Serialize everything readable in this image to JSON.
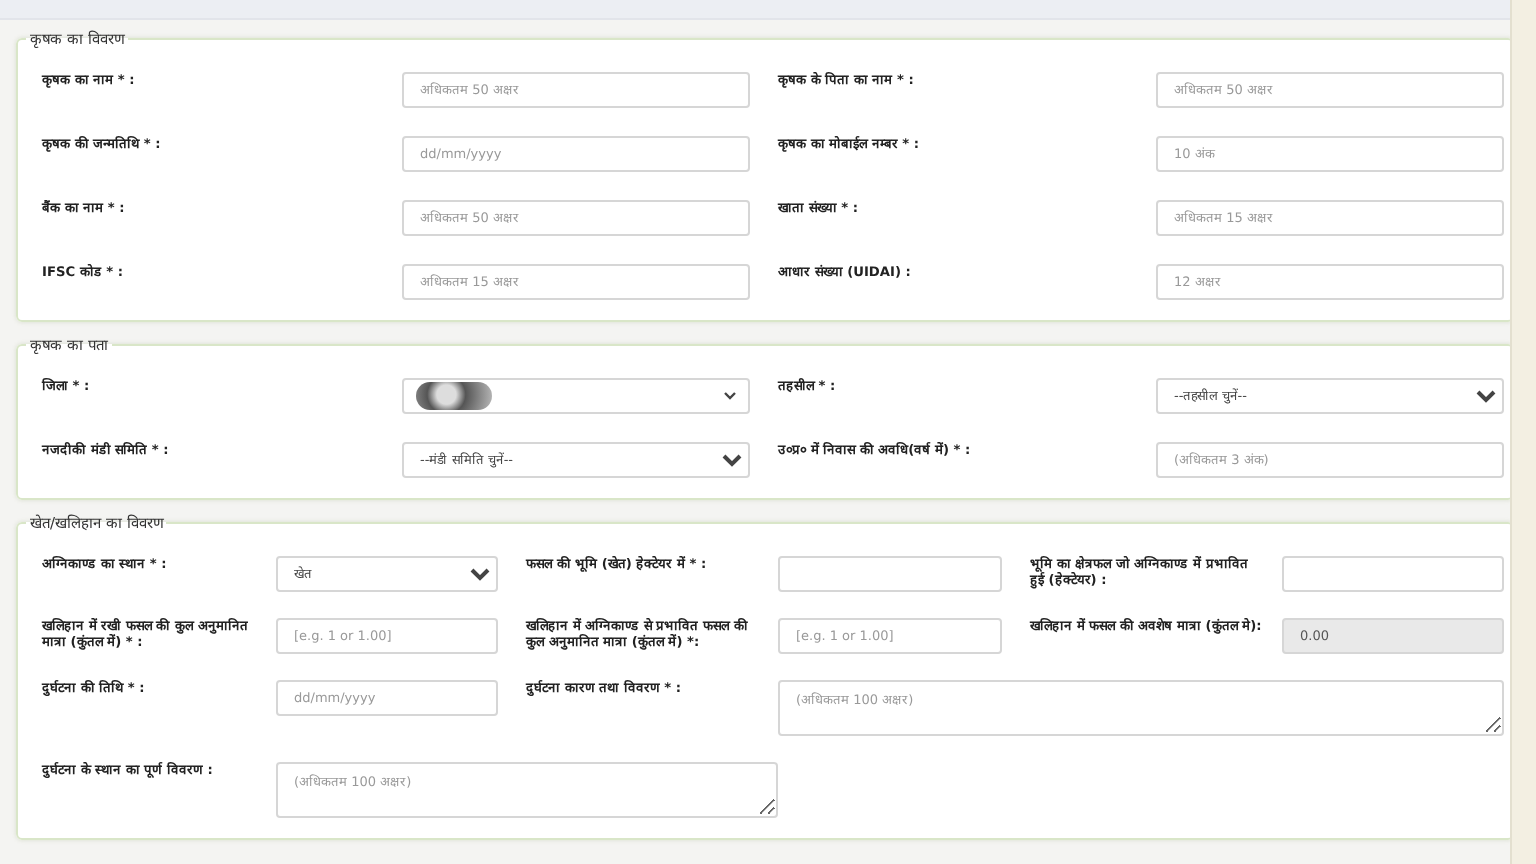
{
  "sections": [
    {
      "legend": "कृषक का विवरण",
      "kind": "pairs",
      "rows": [
        [
          {
            "label": "कृषक का नाम * :",
            "control": {
              "kind": "input",
              "placeholder": "अधिकतम 50 अक्षर",
              "disabled": false
            }
          },
          {
            "label": "कृषक के पिता का नाम * :",
            "control": {
              "kind": "input",
              "placeholder": "अधिकतम 50 अक्षर",
              "disabled": false
            }
          }
        ],
        [
          {
            "label": "कृषक की जन्मतिथि * :",
            "control": {
              "kind": "input",
              "placeholder": "dd/mm/yyyy",
              "disabled": false
            }
          },
          {
            "label": "कृषक का मोबाईल नम्बर * :",
            "control": {
              "kind": "input",
              "placeholder": "10 अंक",
              "disabled": false
            }
          }
        ],
        [
          {
            "label": "बैंक का नाम * :",
            "control": {
              "kind": "input",
              "placeholder": "अधिकतम 50 अक्षर",
              "disabled": false
            }
          },
          {
            "label": "खाता संख्या * :",
            "control": {
              "kind": "input",
              "placeholder": "अधिकतम 15 अक्षर",
              "disabled": false
            }
          }
        ],
        [
          {
            "label": "IFSC कोड * :",
            "control": {
              "kind": "input",
              "placeholder": "अधिकतम 15 अक्षर",
              "disabled": false
            }
          },
          {
            "label": "आधार संख्या (UIDAI) :",
            "control": {
              "kind": "input",
              "placeholder": "12 अक्षर",
              "disabled": false
            }
          }
        ]
      ]
    },
    {
      "legend": "कृषक का पता",
      "kind": "pairs",
      "rows": [
        [
          {
            "label": "जिला * :",
            "control": {
              "kind": "redacted",
              "disabled": false
            }
          },
          {
            "label": "तहसील * :",
            "control": {
              "kind": "select",
              "value": "--तहसील चुनें--",
              "disabled": false
            }
          }
        ],
        [
          {
            "label": "नजदीकी मंडी समिति * :",
            "control": {
              "kind": "select",
              "value": "--मंडी समिति चुनें--",
              "disabled": false
            }
          },
          {
            "label": "उ०प्र० में निवास की अवधि(वर्ष में) * :",
            "control": {
              "kind": "input",
              "placeholder": "(अधिकतम 3 अंक)",
              "disabled": false
            }
          }
        ]
      ]
    },
    {
      "legend": "खेत/खलिहान का विवरण",
      "kind": "triples",
      "rows": [
        [
          {
            "label": "अग्निकाण्ड का स्थान * :",
            "control": {
              "kind": "select",
              "value": "खेत",
              "disabled": false
            }
          },
          {
            "label": "फसल की भूमि (खेत) हेक्टेयर में * :",
            "control": {
              "kind": "input",
              "disabled": false
            }
          },
          {
            "label": "भूमि का क्षेत्रफल जो अग्निकाण्ड में प्रभावित हुई (हेक्टेयर) :",
            "control": {
              "kind": "input",
              "disabled": false
            }
          }
        ],
        [
          {
            "label": "खलिहान में रखी फसल की कुल अनुमानित मात्रा (कुंतल में) * :",
            "control": {
              "kind": "input",
              "placeholder": "[e.g. 1 or 1.00]",
              "disabled": false
            }
          },
          {
            "label": "खलिहान में अग्निकाण्ड से प्रभावित फसल की कुल अनुमानित मात्रा (कुंतल में) *:",
            "control": {
              "kind": "input",
              "placeholder": "[e.g. 1 or 1.00]",
              "disabled": false
            }
          },
          {
            "label": "खलिहान में फसल की अवशेष मात्रा (कुंतल मे):",
            "control": {
              "kind": "input",
              "value": "0.00",
              "disabled": true
            }
          }
        ],
        [
          {
            "label": "दुर्घटना की तिथि * :",
            "control": {
              "kind": "input",
              "placeholder": "dd/mm/yyyy",
              "disabled": false
            }
          },
          {
            "label": "दुर्घटना कारण तथा विवरण * :",
            "control": {
              "kind": "textarea",
              "placeholder": "(अधिकतम 100 अक्षर)",
              "disabled": false
            }
          }
        ],
        [
          {
            "label": "दुर्घटना के स्थान का पूर्ण विवरण :",
            "control": {
              "kind": "textarea",
              "placeholder": "(अधिकतम 100 अक्षर)",
              "disabled": false
            }
          }
        ]
      ]
    }
  ]
}
